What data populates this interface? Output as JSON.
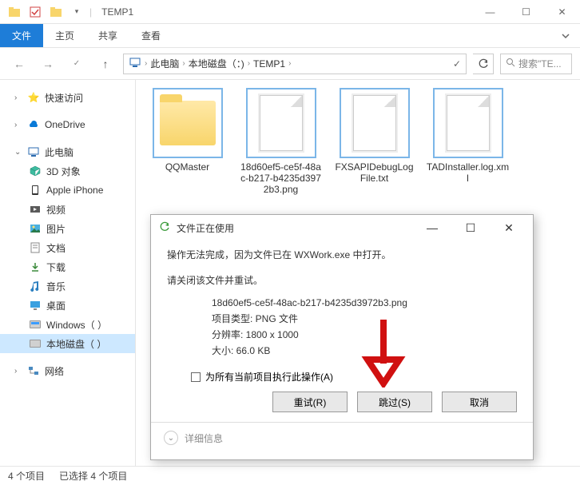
{
  "titlebar": {
    "title": "TEMP1"
  },
  "win_controls": {
    "min": "—",
    "max": "☐",
    "close": "✕"
  },
  "ribbon": {
    "file": "文件",
    "tabs": [
      "主页",
      "共享",
      "查看"
    ]
  },
  "nav": {
    "breadcrumb": {
      "root_icon": "pc-icon",
      "segs": [
        "此电脑",
        "本地磁盘（：)",
        "TEMP1"
      ]
    },
    "search_placeholder": "搜索\"TE..."
  },
  "sidebar": {
    "quick_access": "快速访问",
    "onedrive": "OneDrive",
    "this_pc": "此电脑",
    "children": [
      {
        "label": "3D 对象",
        "icon": "cube"
      },
      {
        "label": "Apple iPhone",
        "icon": "phone"
      },
      {
        "label": "视频",
        "icon": "video"
      },
      {
        "label": "图片",
        "icon": "pictures"
      },
      {
        "label": "文档",
        "icon": "docs"
      },
      {
        "label": "下载",
        "icon": "download"
      },
      {
        "label": "音乐",
        "icon": "music"
      },
      {
        "label": "桌面",
        "icon": "desktop"
      },
      {
        "label": "Windows（ ）",
        "icon": "disk-blue"
      },
      {
        "label": "本地磁盘（ ）",
        "icon": "disk"
      }
    ],
    "network": "网络"
  },
  "files": [
    {
      "name": "QQMaster",
      "type": "folder"
    },
    {
      "name": "18d60ef5-ce5f-48ac-b217-b4235d3972b3.png",
      "type": "file"
    },
    {
      "name": "FXSAPIDebugLogFile.txt",
      "type": "file"
    },
    {
      "name": "TADInstaller.log.xml",
      "type": "file"
    }
  ],
  "statusbar": {
    "count": "4 个项目",
    "selected": "已选择 4 个项目"
  },
  "dialog": {
    "title": "文件正在使用",
    "msg1": "操作无法完成，因为文件已在 WXWork.exe 中打开。",
    "msg2": "请关闭该文件并重试。",
    "fname": "18d60ef5-ce5f-48ac-b217-b4235d3972b3.png",
    "ftype": "项目类型: PNG 文件",
    "fdim": "分辨率: 1800 x 1000",
    "fsize": "大小: 66.0 KB",
    "checkbox": "为所有当前项目执行此操作(A)",
    "btn_retry": "重试(R)",
    "btn_skip": "跳过(S)",
    "btn_cancel": "取消",
    "details": "详细信息"
  }
}
